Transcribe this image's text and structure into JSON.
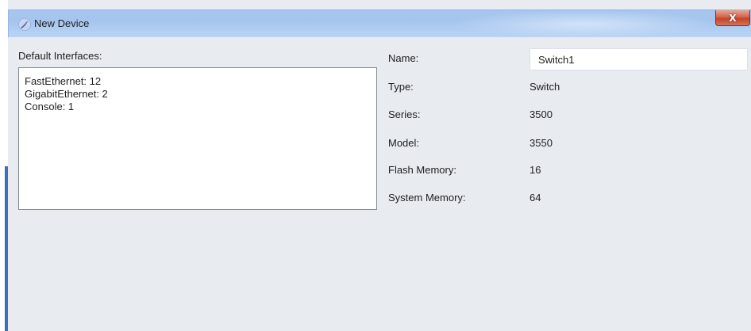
{
  "window": {
    "title": "New Device",
    "close_label": "X"
  },
  "interfaces": {
    "label": "Default Interfaces:",
    "lines": [
      "FastEthernet: 12",
      "GigabitEthernet: 2",
      "Console: 1"
    ]
  },
  "fields": {
    "name": {
      "label": "Name:",
      "value": "Switch1"
    },
    "type": {
      "label": "Type:",
      "value": "Switch"
    },
    "series": {
      "label": "Series:",
      "value": "3500"
    },
    "model": {
      "label": "Model:",
      "value": "3550"
    },
    "flash": {
      "label": "Flash Memory:",
      "value": "16"
    },
    "system": {
      "label": "System Memory:",
      "value": "64"
    }
  },
  "colors": {
    "titlebar": "#a7c6ef",
    "background": "#e8ebf0",
    "close_button": "#c1442b"
  },
  "icons": {
    "app": "circle-swirl-icon",
    "close": "close-icon"
  }
}
